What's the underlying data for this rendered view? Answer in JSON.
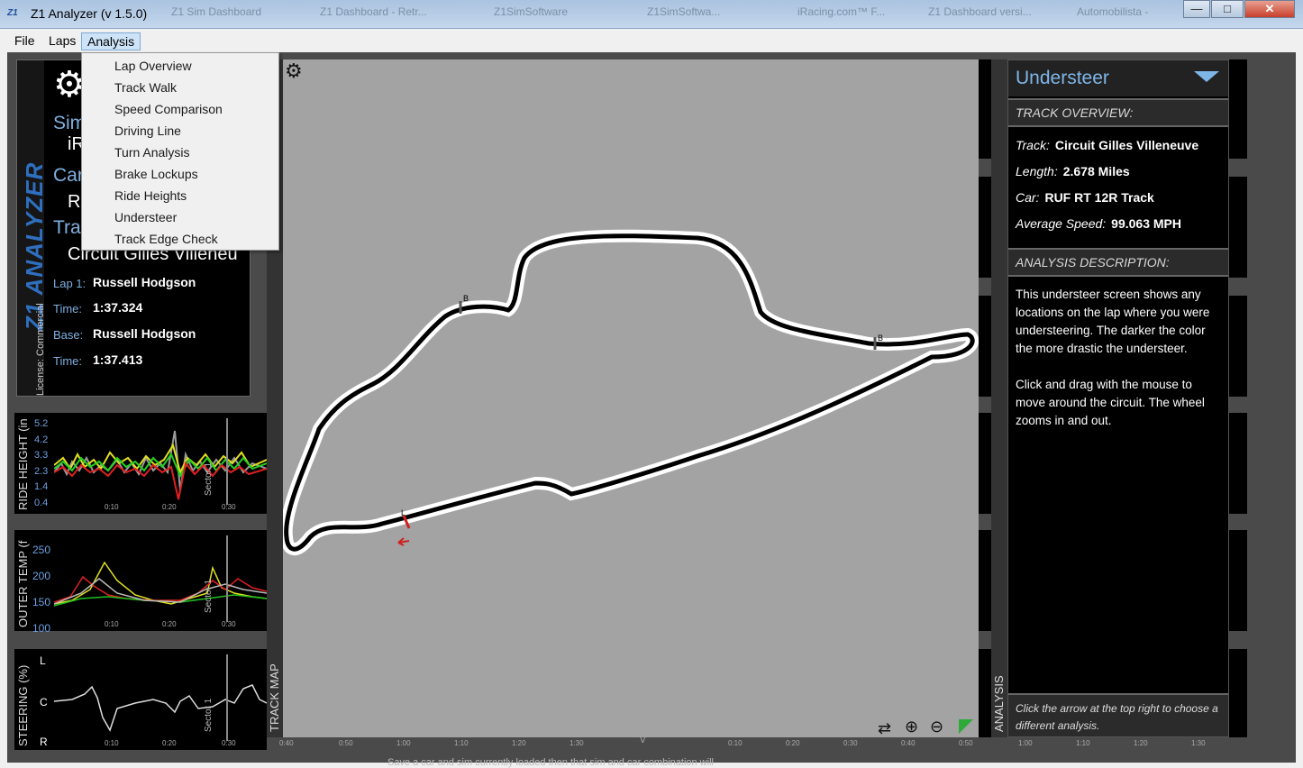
{
  "window": {
    "title": "Z1 Analyzer (v 1.5.0)",
    "logo_text": "Z1",
    "background_tabs": [
      "Z1 Sim Dashboard",
      "Z1 Dashboard - Retr...",
      "Z1SimSoftware",
      "Z1SimSoftwa...",
      "iRacing.com™ F...",
      "Z1 Dashboard versi...",
      "Automobilista -"
    ],
    "minimize_glyph": "—",
    "maximize_glyph": "□",
    "close_glyph": "✕"
  },
  "menubar": {
    "file": "File",
    "laps": "Laps",
    "analysis": "Analysis"
  },
  "analysis_menu": {
    "items": [
      "Lap Overview",
      "Track Walk",
      "Speed Comparison",
      "Driving Line",
      "Turn Analysis",
      "Brake Lockups",
      "Ride Heights",
      "Understeer",
      "Track Edge Check"
    ]
  },
  "info_panel": {
    "brand_vertical": "Z1 ANALYZER",
    "license": "License: Commercial",
    "partial_sim": "Sim",
    "partial_ir": "iR",
    "partial_car": "Car",
    "partial_r": "R",
    "partial_track": "Tra",
    "track_name_partial": "Circuit Gilles Villeneu",
    "lap1_label": "Lap 1:",
    "lap1_driver": "Russell Hodgson",
    "time_label": "Time:",
    "lap1_time": "1:37.324",
    "base_label": "Base:",
    "base_driver": "Russell Hodgson",
    "base_time": "1:37.413"
  },
  "ride_height_chart": {
    "ylabel": "RIDE HEIGHT (in",
    "ticks": [
      "5.2",
      "4.2",
      "3.3",
      "2.3",
      "1.4",
      "0.4"
    ],
    "xticks": [
      "0:10",
      "0:20",
      "0:30"
    ],
    "sector": "Sector 1"
  },
  "outer_temp_chart": {
    "ylabel": "OUTER TEMP (f",
    "ticks": [
      "250",
      "200",
      "150",
      "100"
    ],
    "xticks": [
      "0:10",
      "0:20",
      "0:30"
    ],
    "sector": "Sector 1"
  },
  "steering_chart": {
    "ylabel": "STEERING (%)",
    "ticks": [
      "L",
      "C",
      "R"
    ],
    "xticks": [
      "0:10",
      "0:20",
      "0:30"
    ],
    "sector": "Sector 1"
  },
  "track_map": {
    "label": "TRACK MAP",
    "marker_b1": "B",
    "marker_b2": "B",
    "marker_l": "L",
    "bottom_axis": [
      "0:40",
      "0:50",
      "1:00",
      "1:10",
      "1:20",
      "1:30"
    ],
    "right_axis": [
      "0:10",
      "0:20",
      "0:30",
      "0:40",
      "0:50",
      "1:00",
      "1:10",
      "1:20",
      "1:30"
    ],
    "right_axis_label": "V"
  },
  "analysis_panel": {
    "vertical_label": "ANALYSIS",
    "title": "Understeer",
    "track_overview_header": "TRACK OVERVIEW:",
    "track_label": "Track:",
    "track_value": "Circuit Gilles Villeneuve",
    "length_label": "Length:",
    "length_value": "2.678 Miles",
    "car_label": "Car:",
    "car_value": "RUF RT 12R Track",
    "avg_label": "Average Speed:",
    "avg_value": "99.063 MPH",
    "desc_header": "ANALYSIS DESCRIPTION:",
    "desc_p1": "This understeer screen shows any locations on the lap where you were understeering.  The darker the color the more drastic the understeer.",
    "desc_p2": "Click and drag with the mouse to move around the circuit. The wheel zooms in and out.",
    "footer": "Click the arrow at the top right to choose a different analysis."
  },
  "status_ghost": "Save a car and sim currently loaded then that sim and car combination will"
}
